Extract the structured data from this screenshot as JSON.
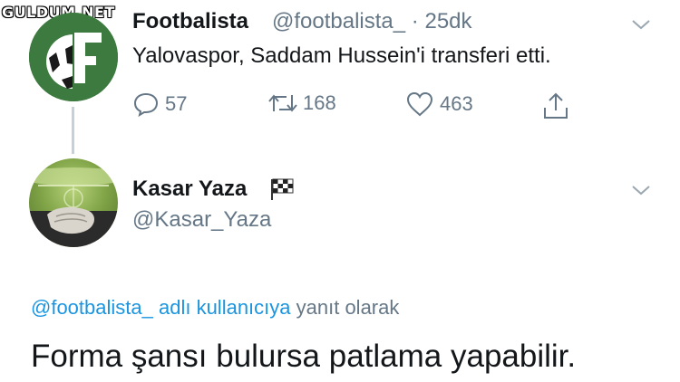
{
  "watermark": "GULDUM.NET",
  "tweet": {
    "author_name": "Footbalista",
    "author_handle": "@footbalista_",
    "separator": "·",
    "time": "25dk",
    "text": "Yalovaspor, Saddam Hussein'i transferi etti.",
    "reply_count": "57",
    "retweet_count": "168",
    "like_count": "463"
  },
  "reply": {
    "author_name": "Kasar Yaza",
    "author_handle": "@Kasar_Yaza",
    "reply_to_handle": "@footbalista_",
    "reply_to_suffix": "adlı kullanıcıya",
    "reply_to_tail": "yanıt olarak",
    "text": "Forma şansı bulursa patlama yapabilir."
  },
  "colors": {
    "text": "#14171a",
    "muted": "#657786",
    "link": "#1b95e0",
    "avatar_green": "#3d7a3f",
    "thread_line": "#c5d0d8"
  },
  "icons": [
    "reply-icon",
    "retweet-icon",
    "like-icon",
    "share-icon",
    "chevron-down-icon",
    "checkered-flag-icon"
  ]
}
